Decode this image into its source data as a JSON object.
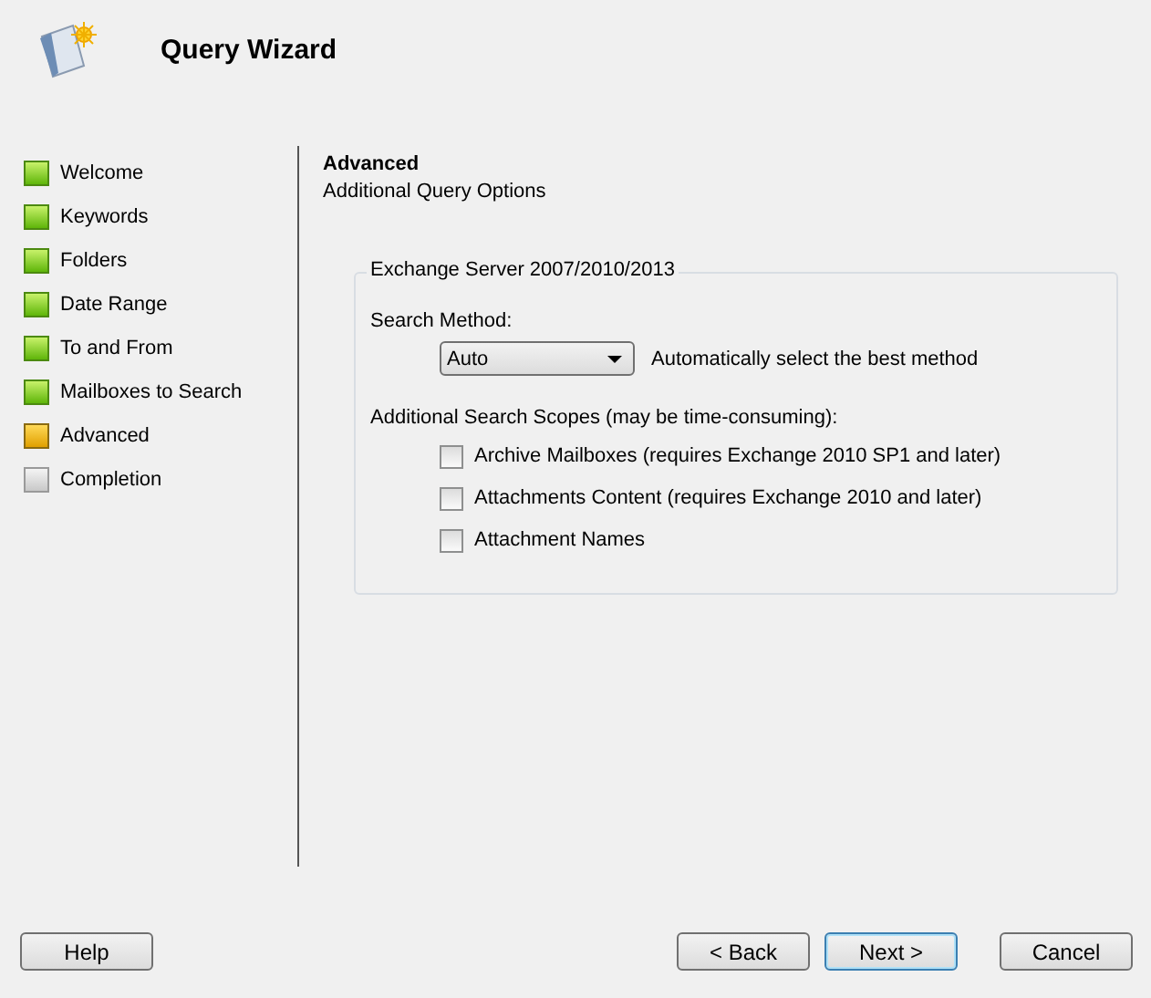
{
  "window": {
    "title": "Query Wizard"
  },
  "steps": [
    {
      "label": "Welcome",
      "kind": "done"
    },
    {
      "label": "Keywords",
      "kind": "done"
    },
    {
      "label": "Folders",
      "kind": "done"
    },
    {
      "label": "Date Range",
      "kind": "done"
    },
    {
      "label": "To and From",
      "kind": "done"
    },
    {
      "label": "Mailboxes to Search",
      "kind": "done"
    },
    {
      "label": "Advanced",
      "kind": "current"
    },
    {
      "label": "Completion",
      "kind": "pending"
    }
  ],
  "page": {
    "title": "Advanced",
    "subtitle": "Additional Query Options"
  },
  "group": {
    "title": "Exchange Server 2007/2010/2013",
    "method_label": "Search Method:",
    "method_value": "Auto",
    "method_hint": "Automatically select the best method",
    "scopes_label": "Additional Search Scopes (may be time-consuming):",
    "scopes": [
      {
        "label": "Archive Mailboxes (requires Exchange 2010 SP1 and later)",
        "checked": false
      },
      {
        "label": "Attachments Content (requires Exchange 2010 and later)",
        "checked": false
      },
      {
        "label": "Attachment Names",
        "checked": false
      }
    ]
  },
  "buttons": [
    {
      "label": "Help",
      "default": false
    },
    {
      "label": "< Back",
      "default": false
    },
    {
      "label": "Next >",
      "default": true
    },
    {
      "label": "Cancel",
      "default": false
    }
  ]
}
